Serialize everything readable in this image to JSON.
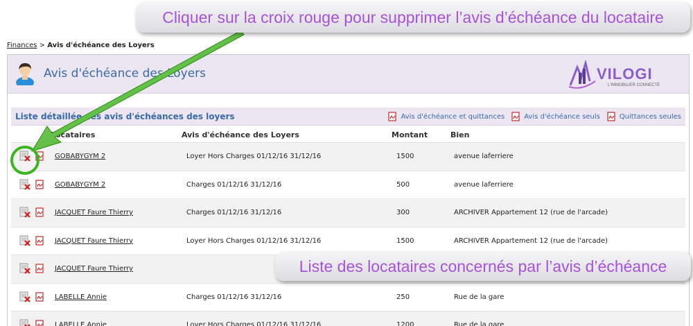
{
  "breadcrumb": {
    "parent": "Finances",
    "separator": " > ",
    "current": "Avis d'échéance des Loyers"
  },
  "page_title": "Avis d'échéance des Loyers",
  "logo": {
    "text": "VILOGI",
    "tagline": "L'IMMOBILIER CONNECTÉ"
  },
  "list": {
    "title": "Liste détaillée des avis d'échéances des loyers",
    "actions": [
      "Avis d'échéance et quittances",
      "Avis d'échéance seuls",
      "Quittances seules"
    ],
    "columns": {
      "tenants": "Locataires",
      "notice": "Avis d'échéance des Loyers",
      "amount": "Montant",
      "property": "Bien"
    },
    "rows": [
      {
        "tenant": "GOBABYGYM 2",
        "notice": "Loyer Hors Charges 01/12/16 31/12/16",
        "amount": "1500",
        "property": "avenue laferriere"
      },
      {
        "tenant": "GOBABYGYM 2",
        "notice": "Charges 01/12/16 31/12/16",
        "amount": "500",
        "property": "avenue laferriere"
      },
      {
        "tenant": "JACQUET Faure Thierry",
        "notice": "Charges 01/12/16 31/12/16",
        "amount": "300",
        "property": "ARCHIVER Appartement 12 (rue de l'arcade)"
      },
      {
        "tenant": "JACQUET Faure Thierry",
        "notice": "Loyer Hors Charges 01/12/16 31/12/16",
        "amount": "1500",
        "property": "ARCHIVER Appartement 12 (rue de l'arcade)"
      },
      {
        "tenant": "JACQUET Faure Thierry",
        "notice": "",
        "amount": "",
        "property": ""
      },
      {
        "tenant": "LABELLE Annie",
        "notice": "Charges 01/12/16 31/12/16",
        "amount": "250",
        "property": "Rue de la gare"
      },
      {
        "tenant": "LABELLE Annie",
        "notice": "Loyer Hors Charges 01/12/16 31/12/16",
        "amount": "1200",
        "property": "Rue de la gare"
      }
    ]
  },
  "callouts": {
    "top": "Cliquer sur la croix rouge pour supprimer l’avis d’échéance du locataire",
    "bottom": "Liste des locataires concernés par l’avis d’échéance"
  },
  "colors": {
    "title_blue": "#3b6aa8",
    "header_bg": "#ebe6f1",
    "callout_text": "#a653d6",
    "arrow_green": "#3cb521",
    "delete_red": "#d42020"
  },
  "icons": {
    "user": "user-avatar-icon",
    "delete": "red-cross-delete-icon",
    "pdf": "pdf-icon"
  }
}
